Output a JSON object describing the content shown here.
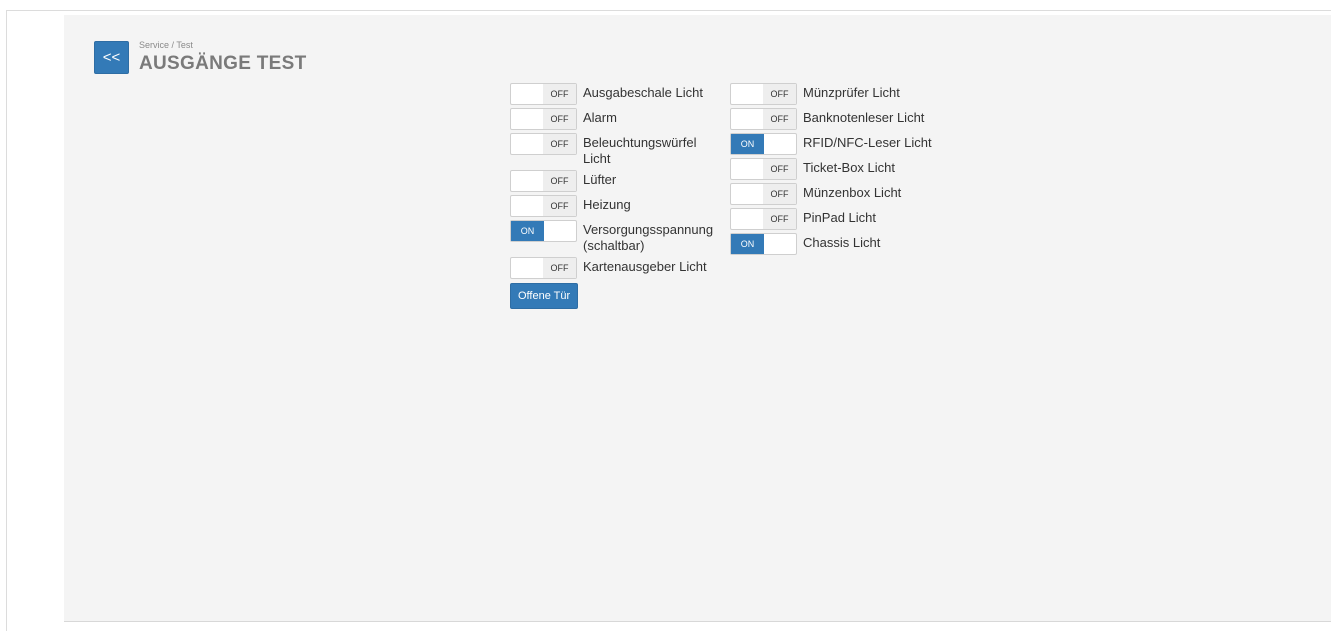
{
  "header": {
    "back_label": "<<",
    "breadcrumb": "Service / Test",
    "title": "AUSGÄNGE TEST"
  },
  "left_column": [
    {
      "label": "Ausgabeschale Licht",
      "state": "OFF"
    },
    {
      "label": "Alarm",
      "state": "OFF"
    },
    {
      "label": "Beleuchtungswürfel Licht",
      "state": "OFF"
    },
    {
      "label": "Lüfter",
      "state": "OFF"
    },
    {
      "label": "Heizung",
      "state": "OFF"
    },
    {
      "label": "Versorgungsspannung (schaltbar)",
      "state": "ON"
    },
    {
      "label": "Kartenausgeber Licht",
      "state": "OFF"
    }
  ],
  "right_column": [
    {
      "label": "Münzprüfer Licht",
      "state": "OFF"
    },
    {
      "label": "Banknotenleser Licht",
      "state": "OFF"
    },
    {
      "label": "RFID/NFC-Leser Licht",
      "state": "ON"
    },
    {
      "label": "Ticket-Box Licht",
      "state": "OFF"
    },
    {
      "label": "Münzenbox Licht",
      "state": "OFF"
    },
    {
      "label": "PinPad Licht",
      "state": "OFF"
    },
    {
      "label": "Chassis Licht",
      "state": "ON"
    }
  ],
  "door_button_label": "Offene Tür",
  "toggle_on_text": "ON",
  "toggle_off_text": "OFF",
  "colors": {
    "accent": "#337ab7",
    "panel": "#f4f4f4"
  }
}
